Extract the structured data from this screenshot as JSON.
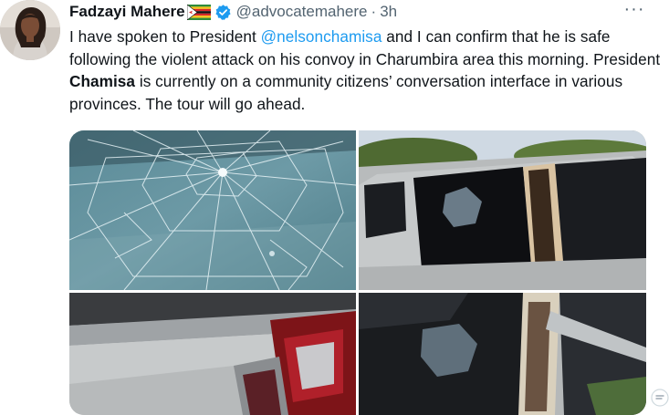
{
  "tweet": {
    "author_name": "Fadzayi Mahere",
    "handle": "@advocatemahere",
    "separator": "·",
    "time": "3h",
    "text_parts": {
      "t1": "I have spoken to President ",
      "mention": "@nelsonchamisa",
      "t2": " and I can confirm that he is safe following the violent attack on his convoy in Charumbira area this morning. President ",
      "bold": "Chamisa",
      "t3": " is currently on a community citizens’ conversation interface in various provinces. The tour will go ahead."
    },
    "more_label": "···"
  },
  "icons": {
    "verified": "verified-badge-icon",
    "flag": "zimbabwe-flag-emoji",
    "more": "more-options-icon"
  },
  "colors": {
    "link": "#1d9bf0",
    "secondary_text": "#536471",
    "verified": "#1d9bf0"
  }
}
